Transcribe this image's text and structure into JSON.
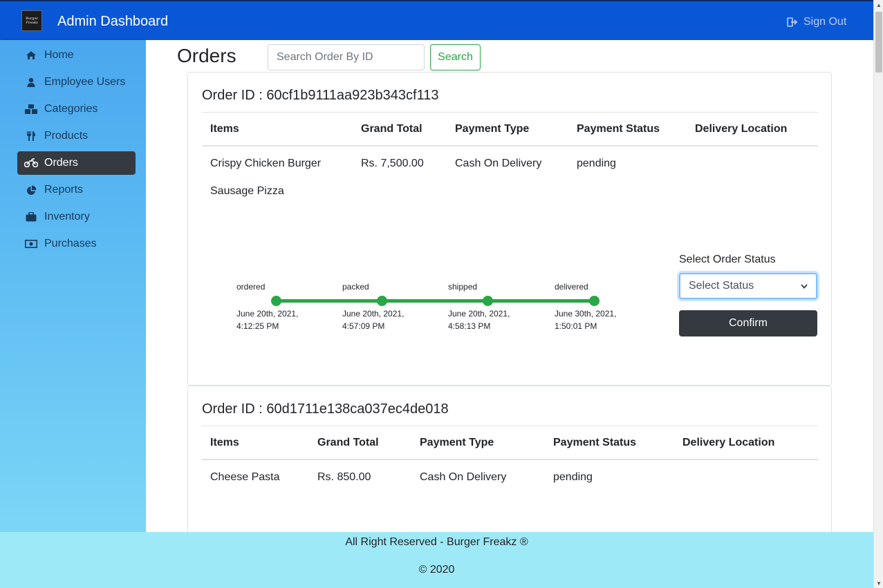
{
  "header": {
    "logo_text": "Burger Freakz",
    "title": "Admin Dashboard",
    "signout_label": "Sign Out",
    "signout_icon": "sign-out-icon"
  },
  "sidebar": {
    "items": [
      {
        "label": "Home",
        "icon": "home-icon",
        "active": false
      },
      {
        "label": "Employee Users",
        "icon": "user-icon",
        "active": false
      },
      {
        "label": "Categories",
        "icon": "cubes-icon",
        "active": false
      },
      {
        "label": "Products",
        "icon": "utensils-icon",
        "active": false
      },
      {
        "label": "Orders",
        "icon": "motorcycle-icon",
        "active": true
      },
      {
        "label": "Reports",
        "icon": "pie-chart-icon",
        "active": false
      },
      {
        "label": "Inventory",
        "icon": "briefcase-icon",
        "active": false
      },
      {
        "label": "Purchases",
        "icon": "money-bill-icon",
        "active": false
      }
    ]
  },
  "main": {
    "title": "Orders",
    "search_placeholder": "Search Order By ID",
    "search_button": "Search"
  },
  "orders": [
    {
      "id_label": "Order ID : 60cf1b9111aa923b343cf113",
      "columns": [
        "Items",
        "Grand Total",
        "Payment Type",
        "Payment Status",
        "Delivery Location"
      ],
      "items": [
        "Crispy Chicken Burger",
        "Sausage Pizza"
      ],
      "grand_total": "Rs. 7,500.00",
      "payment_type": "Cash On Delivery",
      "payment_status": "pending",
      "delivery_location": "",
      "timeline": [
        {
          "label": "ordered",
          "date_line1": "June 20th, 2021,",
          "date_line2": "4:12:25 PM"
        },
        {
          "label": "packed",
          "date_line1": "June 20th, 2021,",
          "date_line2": "4:57:09 PM"
        },
        {
          "label": "shipped",
          "date_line1": "June 20th, 2021,",
          "date_line2": "4:58:13 PM"
        },
        {
          "label": "delivered",
          "date_line1": "June 30th, 2021,",
          "date_line2": "1:50:01 PM"
        }
      ],
      "status_label": "Select Order Status",
      "status_select_value": "Select Status",
      "confirm_button": "Confirm"
    },
    {
      "id_label": "Order ID : 60d1711e138ca037ec4de018",
      "columns": [
        "Items",
        "Grand Total",
        "Payment Type",
        "Payment Status",
        "Delivery Location"
      ],
      "items": [
        "Cheese Pasta"
      ],
      "grand_total": "Rs. 850.00",
      "payment_type": "Cash On Delivery",
      "payment_status": "pending",
      "delivery_location": ""
    }
  ],
  "footer": {
    "line1": "All Right Reserved - Burger Freakz ®",
    "line2": "© 2020"
  },
  "colors": {
    "header_bg": "#0a57d6",
    "accent_green": "#28a745",
    "active_nav_bg": "#343a40",
    "footer_bg": "#9ee9f8"
  }
}
